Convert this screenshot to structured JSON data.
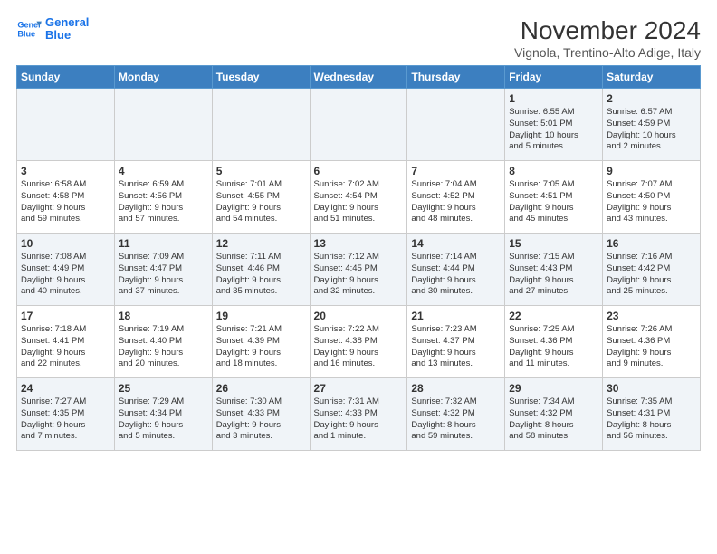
{
  "logo": {
    "line1": "General",
    "line2": "Blue"
  },
  "title": "November 2024",
  "location": "Vignola, Trentino-Alto Adige, Italy",
  "weekdays": [
    "Sunday",
    "Monday",
    "Tuesday",
    "Wednesday",
    "Thursday",
    "Friday",
    "Saturday"
  ],
  "weeks": [
    [
      {
        "day": "",
        "info": ""
      },
      {
        "day": "",
        "info": ""
      },
      {
        "day": "",
        "info": ""
      },
      {
        "day": "",
        "info": ""
      },
      {
        "day": "",
        "info": ""
      },
      {
        "day": "1",
        "info": "Sunrise: 6:55 AM\nSunset: 5:01 PM\nDaylight: 10 hours\nand 5 minutes."
      },
      {
        "day": "2",
        "info": "Sunrise: 6:57 AM\nSunset: 4:59 PM\nDaylight: 10 hours\nand 2 minutes."
      }
    ],
    [
      {
        "day": "3",
        "info": "Sunrise: 6:58 AM\nSunset: 4:58 PM\nDaylight: 9 hours\nand 59 minutes."
      },
      {
        "day": "4",
        "info": "Sunrise: 6:59 AM\nSunset: 4:56 PM\nDaylight: 9 hours\nand 57 minutes."
      },
      {
        "day": "5",
        "info": "Sunrise: 7:01 AM\nSunset: 4:55 PM\nDaylight: 9 hours\nand 54 minutes."
      },
      {
        "day": "6",
        "info": "Sunrise: 7:02 AM\nSunset: 4:54 PM\nDaylight: 9 hours\nand 51 minutes."
      },
      {
        "day": "7",
        "info": "Sunrise: 7:04 AM\nSunset: 4:52 PM\nDaylight: 9 hours\nand 48 minutes."
      },
      {
        "day": "8",
        "info": "Sunrise: 7:05 AM\nSunset: 4:51 PM\nDaylight: 9 hours\nand 45 minutes."
      },
      {
        "day": "9",
        "info": "Sunrise: 7:07 AM\nSunset: 4:50 PM\nDaylight: 9 hours\nand 43 minutes."
      }
    ],
    [
      {
        "day": "10",
        "info": "Sunrise: 7:08 AM\nSunset: 4:49 PM\nDaylight: 9 hours\nand 40 minutes."
      },
      {
        "day": "11",
        "info": "Sunrise: 7:09 AM\nSunset: 4:47 PM\nDaylight: 9 hours\nand 37 minutes."
      },
      {
        "day": "12",
        "info": "Sunrise: 7:11 AM\nSunset: 4:46 PM\nDaylight: 9 hours\nand 35 minutes."
      },
      {
        "day": "13",
        "info": "Sunrise: 7:12 AM\nSunset: 4:45 PM\nDaylight: 9 hours\nand 32 minutes."
      },
      {
        "day": "14",
        "info": "Sunrise: 7:14 AM\nSunset: 4:44 PM\nDaylight: 9 hours\nand 30 minutes."
      },
      {
        "day": "15",
        "info": "Sunrise: 7:15 AM\nSunset: 4:43 PM\nDaylight: 9 hours\nand 27 minutes."
      },
      {
        "day": "16",
        "info": "Sunrise: 7:16 AM\nSunset: 4:42 PM\nDaylight: 9 hours\nand 25 minutes."
      }
    ],
    [
      {
        "day": "17",
        "info": "Sunrise: 7:18 AM\nSunset: 4:41 PM\nDaylight: 9 hours\nand 22 minutes."
      },
      {
        "day": "18",
        "info": "Sunrise: 7:19 AM\nSunset: 4:40 PM\nDaylight: 9 hours\nand 20 minutes."
      },
      {
        "day": "19",
        "info": "Sunrise: 7:21 AM\nSunset: 4:39 PM\nDaylight: 9 hours\nand 18 minutes."
      },
      {
        "day": "20",
        "info": "Sunrise: 7:22 AM\nSunset: 4:38 PM\nDaylight: 9 hours\nand 16 minutes."
      },
      {
        "day": "21",
        "info": "Sunrise: 7:23 AM\nSunset: 4:37 PM\nDaylight: 9 hours\nand 13 minutes."
      },
      {
        "day": "22",
        "info": "Sunrise: 7:25 AM\nSunset: 4:36 PM\nDaylight: 9 hours\nand 11 minutes."
      },
      {
        "day": "23",
        "info": "Sunrise: 7:26 AM\nSunset: 4:36 PM\nDaylight: 9 hours\nand 9 minutes."
      }
    ],
    [
      {
        "day": "24",
        "info": "Sunrise: 7:27 AM\nSunset: 4:35 PM\nDaylight: 9 hours\nand 7 minutes."
      },
      {
        "day": "25",
        "info": "Sunrise: 7:29 AM\nSunset: 4:34 PM\nDaylight: 9 hours\nand 5 minutes."
      },
      {
        "day": "26",
        "info": "Sunrise: 7:30 AM\nSunset: 4:33 PM\nDaylight: 9 hours\nand 3 minutes."
      },
      {
        "day": "27",
        "info": "Sunrise: 7:31 AM\nSunset: 4:33 PM\nDaylight: 9 hours\nand 1 minute."
      },
      {
        "day": "28",
        "info": "Sunrise: 7:32 AM\nSunset: 4:32 PM\nDaylight: 8 hours\nand 59 minutes."
      },
      {
        "day": "29",
        "info": "Sunrise: 7:34 AM\nSunset: 4:32 PM\nDaylight: 8 hours\nand 58 minutes."
      },
      {
        "day": "30",
        "info": "Sunrise: 7:35 AM\nSunset: 4:31 PM\nDaylight: 8 hours\nand 56 minutes."
      }
    ]
  ]
}
